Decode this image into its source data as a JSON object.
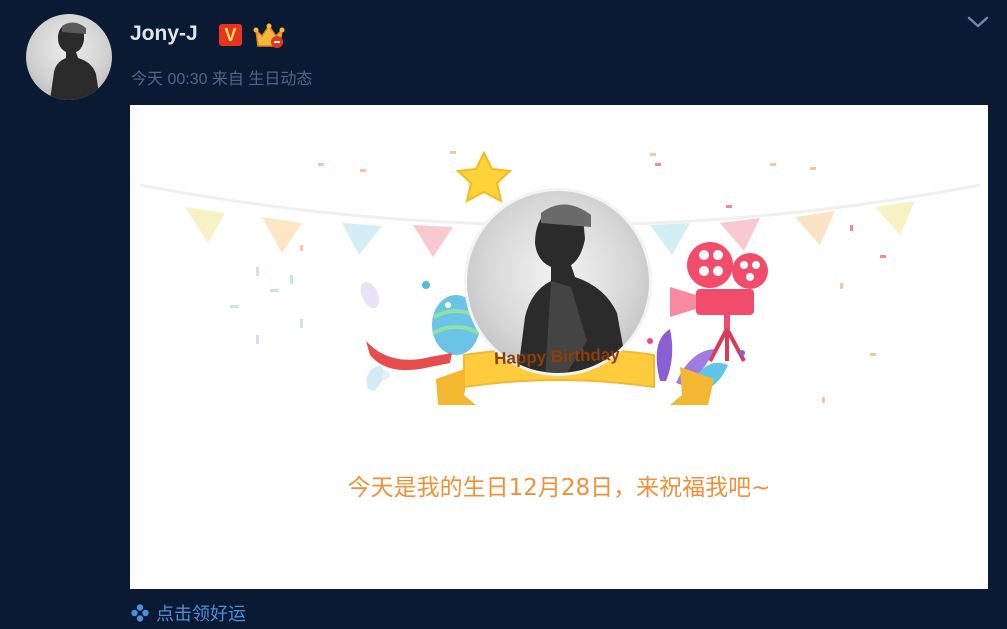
{
  "post": {
    "username": "Jony-J",
    "verified_badge": "V",
    "meta": "今天 00:30 来自 生日动态"
  },
  "card": {
    "ribbon_text": "Happy Birthday",
    "message": "今天是我的生日12月28日，来祝福我吧~"
  },
  "actions": {
    "luck_label": "点击领好运"
  },
  "icons": {
    "verified": "v-badge-icon",
    "crown": "crown-badge-icon",
    "expand": "chevron-down-icon",
    "luck": "clover-icon"
  },
  "colors": {
    "background": "#0b1a33",
    "username": "#dfe6ee",
    "meta": "#4e6789",
    "message": "#f0913a",
    "link": "#4f8fd9",
    "badge_red": "#e8341e"
  }
}
